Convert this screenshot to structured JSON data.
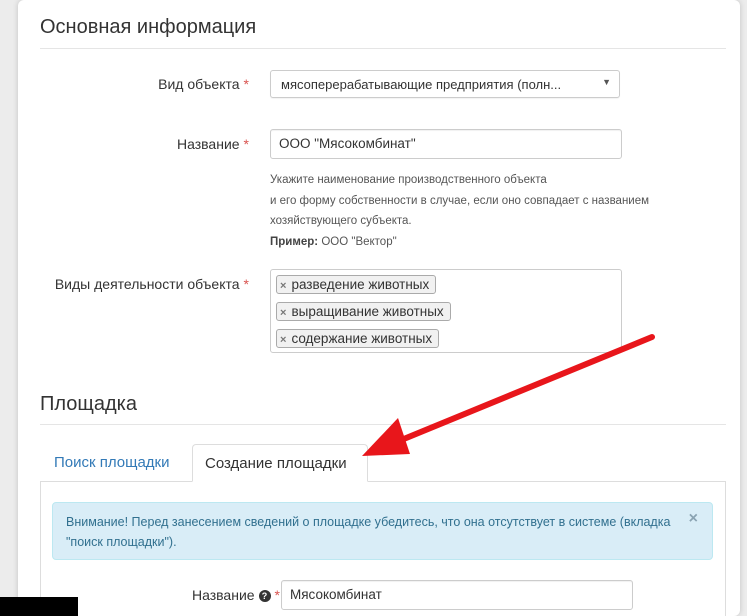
{
  "section_main": {
    "title": "Основная информация"
  },
  "object_type": {
    "label": "Вид объекта",
    "required_mark": "*",
    "value": "мясоперерабатывающие предприятия (полн...",
    "caret": "▼"
  },
  "object_name": {
    "label": "Название",
    "required_mark": "*",
    "value": "ООО \"Мясокомбинат\"",
    "help_line1": "Укажите наименование производственного объекта",
    "help_line2": "и его форму собственности в случае, если оно совпадает с названием",
    "help_line3": "хозяйствующего субъекта.",
    "example_label": "Пример:",
    "example_value": "ООО \"Вектор\""
  },
  "activities": {
    "label": "Виды деятельности объекта",
    "required_mark": "*",
    "remove_glyph": "×",
    "tags": [
      "разведение животных",
      "выращивание животных",
      "содержание животных"
    ]
  },
  "section_site": {
    "title": "Площадка"
  },
  "tabs": [
    {
      "label": "Поиск площадки"
    },
    {
      "label": "Создание площадки"
    }
  ],
  "alert": {
    "text": "Внимание! Перед занесением сведений о площадке убедитесь, что она отсутствует в системе (вкладка \"поиск площадки\").",
    "close": "×"
  },
  "site_name": {
    "label": "Название",
    "help_icon": "?",
    "required_mark": "*",
    "value": "Мясокомбинат"
  },
  "colors": {
    "link": "#337ab7",
    "required": "#d9534f",
    "alert_bg": "#d9edf7",
    "arrow": "#e8161b"
  }
}
